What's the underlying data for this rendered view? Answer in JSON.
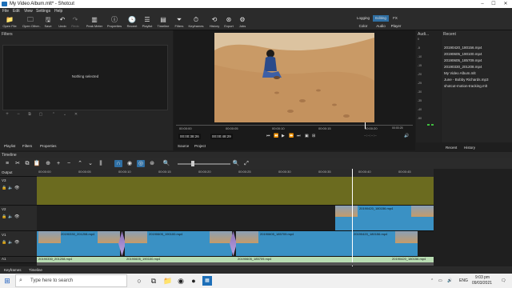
{
  "window": {
    "title": "My Video Album.mlt* - Shotcut"
  },
  "menu": [
    "File",
    "Edit",
    "View",
    "Settings",
    "Help"
  ],
  "toolbar": {
    "buttons": [
      "Open File",
      "Open Other..",
      "Save",
      "Undo",
      "Redo",
      "Peak Meter",
      "Properties",
      "Recent",
      "Playlist",
      "Timeline",
      "Filters",
      "Keyframes",
      "History",
      "Export",
      "Jobs"
    ],
    "layouts": [
      "Logging",
      "Editing",
      "FX",
      "Color",
      "Audio",
      "Player"
    ]
  },
  "filters": {
    "title": "Filters",
    "empty_text": "Nothing selected"
  },
  "player": {
    "ruler_labels": [
      "00:00:00",
      "00:00:05",
      "00:00:10",
      "00:00:15",
      "00:00:20",
      "00:00:25"
    ],
    "timecode_current": "00:00:38:26",
    "timecode_total": "00:00:48:29",
    "out_marker": "--:--:--:--",
    "source_tabs": [
      "Source",
      "Project"
    ]
  },
  "audio_meter": {
    "title": "Audi...",
    "db_labels": [
      "0",
      "-5",
      "-10",
      "-15",
      "-20",
      "-25",
      "-30",
      "-35",
      "-40",
      "-50"
    ]
  },
  "recent": {
    "title": "Recent",
    "items": [
      "20190420_180156.mp4",
      "20190605_190100.mp4",
      "20190605_185709.mp4",
      "20190330_201208.mp4",
      "My Video Album.mlt",
      "June - Bobby Richards.mp3",
      "shotcut-motion-tracking.mlt"
    ],
    "tabs": [
      "Recent",
      "History"
    ]
  },
  "left_tabs": [
    "Playlist",
    "Filters",
    "Properties"
  ],
  "timeline": {
    "title": "Timeline",
    "ruler_labels": [
      "00:00:00",
      "00:00:05",
      "00:00:10",
      "00:00:15",
      "00:00:20",
      "00:00:25",
      "00:00:30",
      "00:00:35",
      "00:00:40",
      "00:00:45"
    ],
    "tracks": [
      {
        "name": "Output"
      },
      {
        "name": "V3"
      },
      {
        "name": "V2",
        "clips": [
          "20190420_180156.mp4"
        ]
      },
      {
        "name": "V1",
        "clips": [
          "20190330_201208.mp4",
          "20190605_190100.mp4",
          "20190605_185709.mp4",
          "20190420_180156.mp4"
        ]
      },
      {
        "name": "A1",
        "clips": [
          "20190330_201208.mp4",
          "20190605_190100.mp4",
          "20190605_185709.mp4",
          "20190420_180156.mp4"
        ]
      }
    ]
  },
  "bottom_tabs": [
    "Keyframes",
    "Timeline"
  ],
  "taskbar": {
    "search_placeholder": "Type here to search",
    "time": "9:03 pm",
    "date": "09/03/2021",
    "lang": "ENG"
  }
}
